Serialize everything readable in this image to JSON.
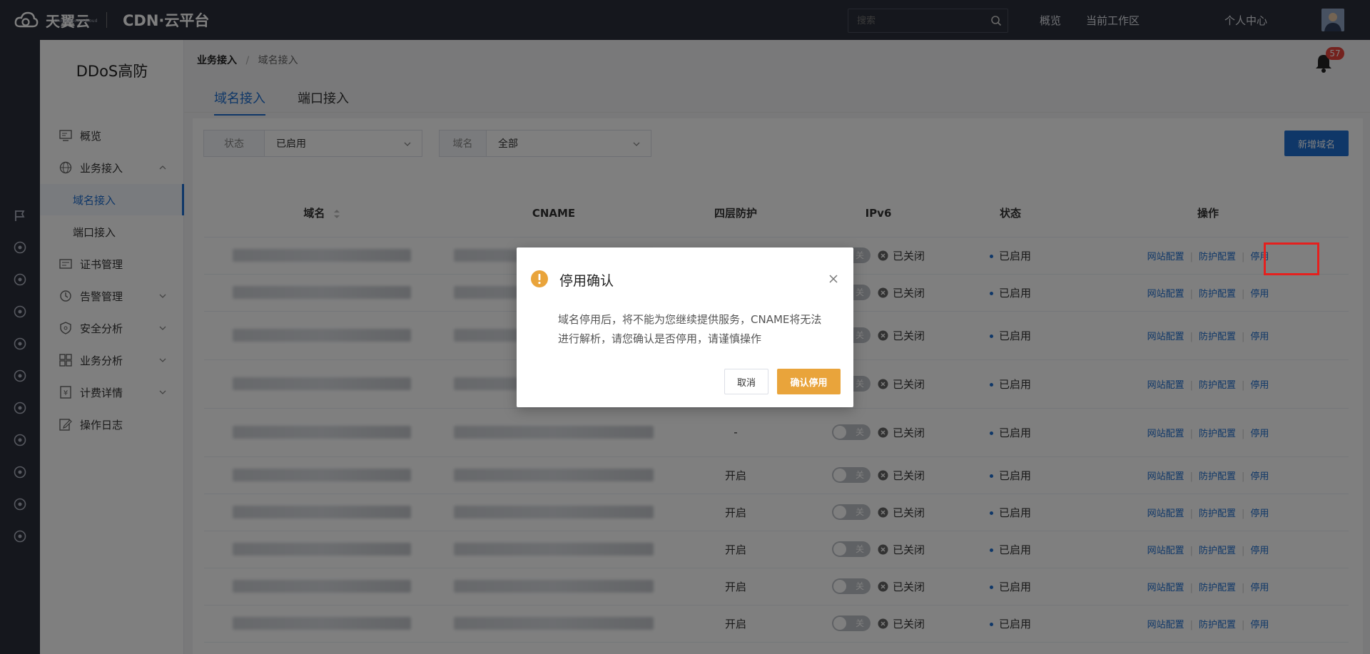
{
  "header": {
    "brand": "天翼云",
    "brand_sub": "Chinatelecom Cloud",
    "product": "CDN·云平台",
    "search_placeholder": "搜索",
    "nav": [
      "概览",
      "当前工作区",
      "个人中心"
    ]
  },
  "sidebar": {
    "title": "DDoS高防",
    "items": [
      {
        "label": "概览",
        "icon": "monitor-icon"
      },
      {
        "label": "业务接入",
        "icon": "globe-icon",
        "expanded": true
      },
      {
        "label": "域名接入",
        "active": true
      },
      {
        "label": "端口接入"
      },
      {
        "label": "证书管理",
        "icon": "certificate-icon"
      },
      {
        "label": "告警管理",
        "icon": "alarm-icon"
      },
      {
        "label": "安全分析",
        "icon": "shield-icon"
      },
      {
        "label": "业务分析",
        "icon": "grid-icon"
      },
      {
        "label": "计费详情",
        "icon": "billing-icon"
      },
      {
        "label": "操作日志",
        "icon": "edit-log-icon"
      }
    ]
  },
  "breadcrumb": {
    "root": "业务接入",
    "sep": "/",
    "current": "域名接入"
  },
  "notifications": {
    "count": "57"
  },
  "tabs": [
    "域名接入",
    "端口接入"
  ],
  "filters": {
    "status": {
      "label": "状态",
      "value": "已启用"
    },
    "domain": {
      "label": "域名",
      "value": "全部"
    }
  },
  "add_button": "新增域名",
  "table": {
    "columns": [
      "域名",
      "CNAME",
      "四层防护",
      "IPv6",
      "状态",
      "操作"
    ],
    "rows": [
      {
        "protect": "",
        "toggle": "关",
        "ipv6": "已关闭",
        "status": "已启用"
      },
      {
        "protect": "",
        "toggle": "关",
        "ipv6": "已关闭",
        "status": "已启用"
      },
      {
        "protect": "",
        "toggle": "关",
        "ipv6": "已关闭",
        "status": "已启用"
      },
      {
        "protect": "",
        "toggle": "关",
        "ipv6": "已关闭",
        "status": "已启用"
      },
      {
        "protect": "-",
        "toggle": "关",
        "ipv6": "已关闭",
        "status": "已启用"
      },
      {
        "protect": "开启",
        "toggle": "关",
        "ipv6": "已关闭",
        "status": "已启用"
      },
      {
        "protect": "开启",
        "toggle": "关",
        "ipv6": "已关闭",
        "status": "已启用"
      },
      {
        "protect": "开启",
        "toggle": "关",
        "ipv6": "已关闭",
        "status": "已启用"
      },
      {
        "protect": "开启",
        "toggle": "关",
        "ipv6": "已关闭",
        "status": "已启用"
      },
      {
        "protect": "开启",
        "toggle": "关",
        "ipv6": "已关闭",
        "status": "已启用"
      }
    ],
    "ops": {
      "site": "网站配置",
      "protect": "防护配置",
      "disable": "停用",
      "sep": "|"
    }
  },
  "dialog": {
    "title": "停用确认",
    "body": "域名停用后，将不能为您继续提供服务，CNAME将无法进行解析，请您确认是否停用，请谨慎操作",
    "cancel": "取消",
    "confirm": "确认停用"
  },
  "colors": {
    "accent": "#1f6fd0",
    "warning": "#e9a43b",
    "highlight": "#e5201e",
    "topbar": "#2b2f3a"
  }
}
